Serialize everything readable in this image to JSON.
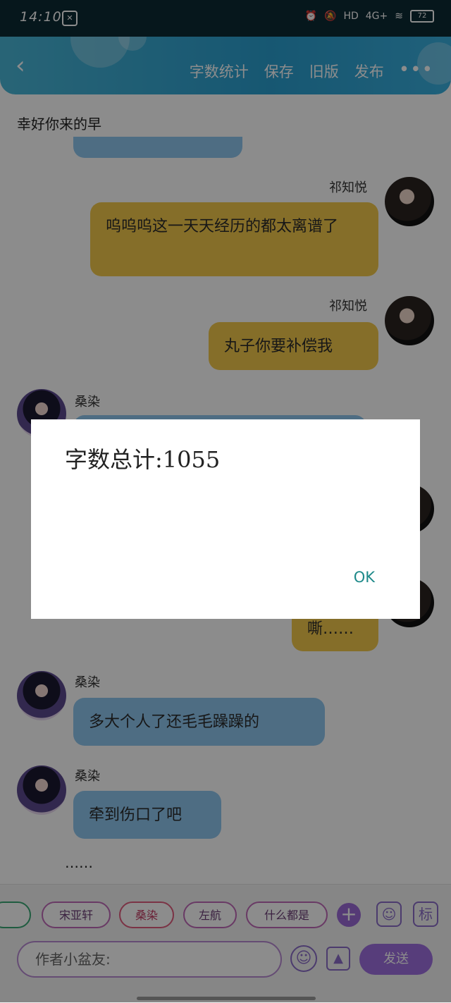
{
  "status_bar": {
    "time": "14:10",
    "network": "4G+",
    "hd": "HD",
    "battery": "72"
  },
  "header": {
    "actions": [
      "字数统计",
      "保存",
      "旧版",
      "发布"
    ],
    "more": "•••"
  },
  "chat": {
    "top_text": "幸好你来的早",
    "messages": [
      {
        "side": "right",
        "name": "祁知悦",
        "text": "呜呜呜这一天天经历的都太离谱了"
      },
      {
        "side": "right",
        "name": "祁知悦",
        "text": "丸子你要补偿我"
      },
      {
        "side": "left",
        "name": "桑染",
        "text": ""
      },
      {
        "side": "right",
        "name": "",
        "text": "嘶……"
      },
      {
        "side": "left",
        "name": "桑染",
        "text": "多大个人了还毛毛躁躁的"
      },
      {
        "side": "left",
        "name": "桑染",
        "text": "牵到伤口了吧"
      }
    ],
    "trailing_text": "……"
  },
  "bottom": {
    "chips": [
      "宋亚轩",
      "桑染",
      "左航",
      "什么都是"
    ],
    "plus": "+",
    "tag_label": "标",
    "input_placeholder": "作者小盆友:",
    "send_label": "发送"
  },
  "dialog": {
    "title": "字数总计:1055",
    "ok_label": "OK"
  },
  "colors": {
    "header": "#2a9fd0",
    "yellow_bubble": "#f2c84b",
    "blue_bubble": "#8fc6ef",
    "accent": "#9f6fe0"
  }
}
